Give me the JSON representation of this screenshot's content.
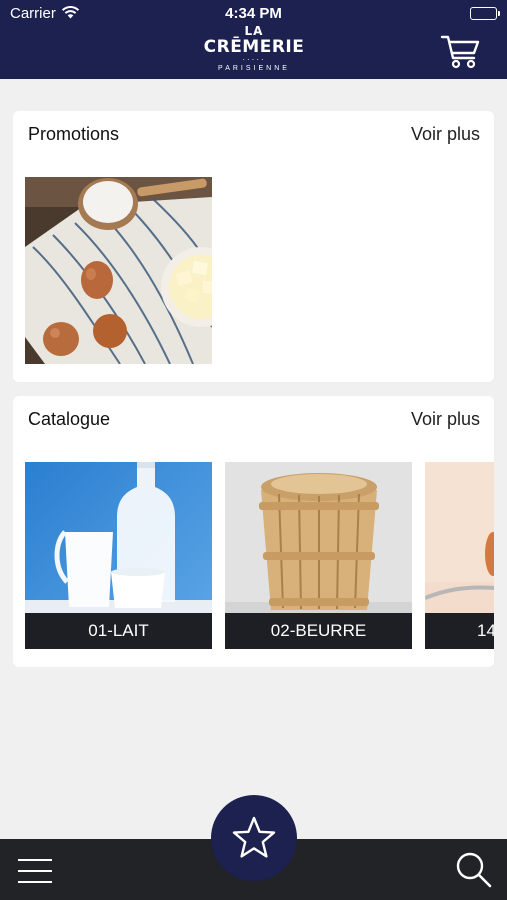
{
  "status_bar": {
    "carrier": "Carrier",
    "time": "4:34 PM"
  },
  "header": {
    "logo_top": "LA",
    "logo_main": "CRĒMERIE",
    "logo_dots": "·····",
    "logo_sub": "PARISIENNE",
    "background": "#1c2150"
  },
  "promotions": {
    "title": "Promotions",
    "more_label": "Voir plus",
    "items": [
      {
        "image": "eggs-flour-butter-photo"
      }
    ]
  },
  "catalogue": {
    "title": "Catalogue",
    "more_label": "Voir plus",
    "items": [
      {
        "label": "01-LAIT",
        "image": "milk-jug-bottle-photo"
      },
      {
        "label": "02-BEURRE",
        "image": "wooden-butter-basket-photo"
      },
      {
        "label": "14",
        "image": "egg-spoon-photo"
      }
    ]
  },
  "tabbar": {
    "menu_icon": "hamburger-menu-icon",
    "favorites_icon": "star-icon",
    "search_icon": "search-icon",
    "background": "#212326"
  }
}
